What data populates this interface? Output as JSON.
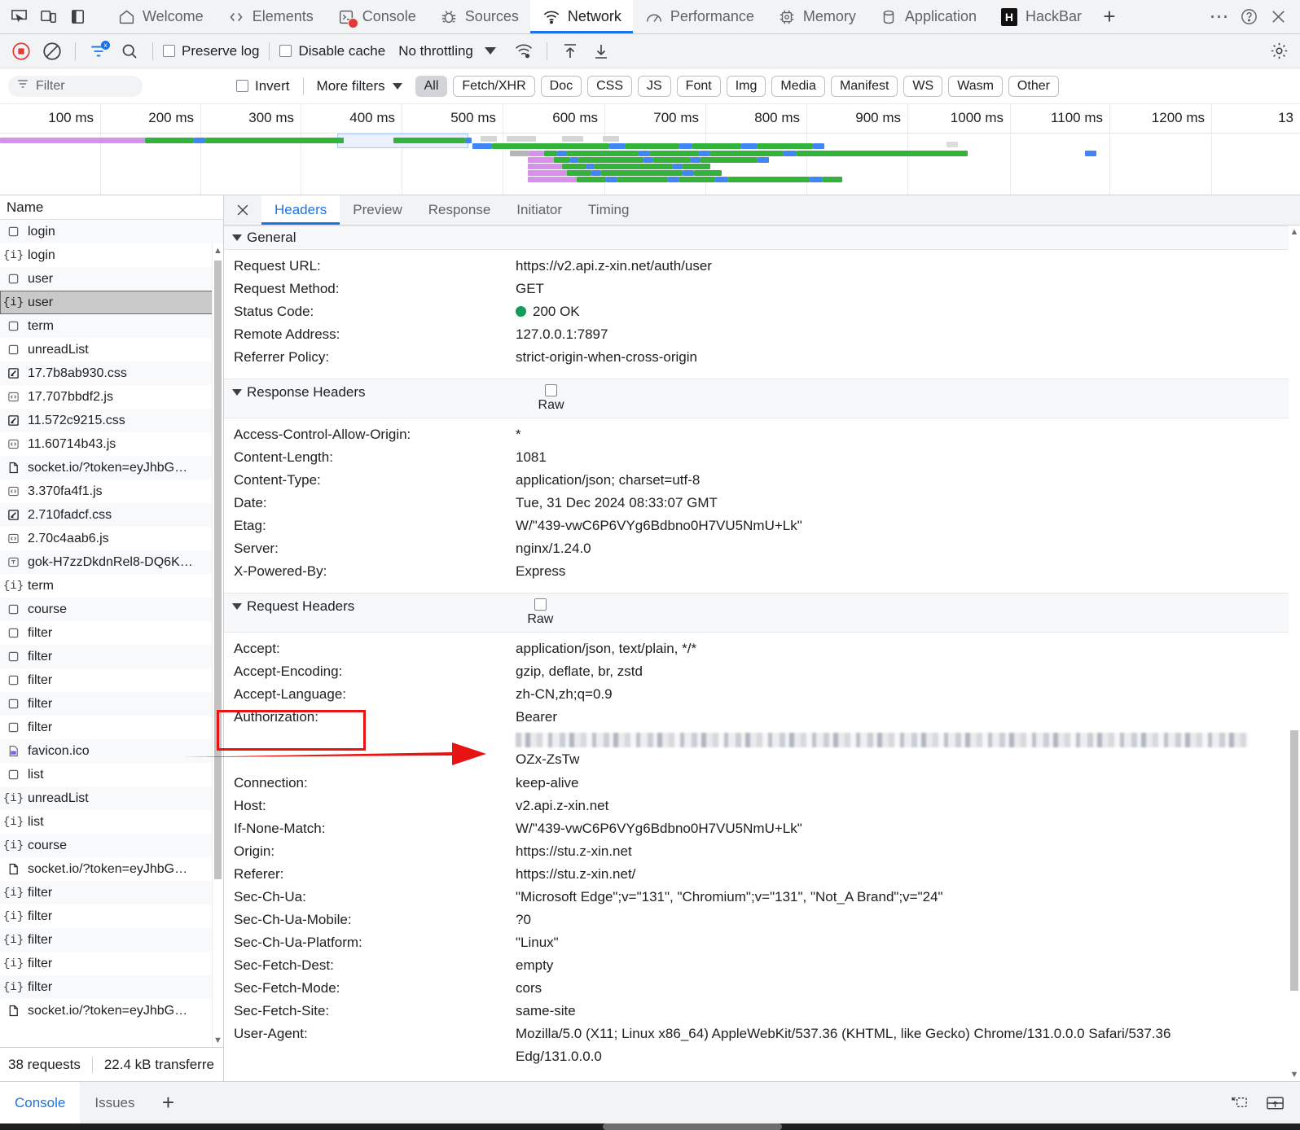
{
  "tabbar": {
    "left_icons": [
      "inspect-icon",
      "device-toolbar-icon",
      "dock-panel-icon"
    ],
    "tabs": [
      {
        "label": "Welcome",
        "icon": "home-icon",
        "active": false
      },
      {
        "label": "Elements",
        "icon": "code-brackets-icon",
        "active": false
      },
      {
        "label": "Console",
        "icon": "console-terminal-icon",
        "active": false,
        "error_badge": true
      },
      {
        "label": "Sources",
        "icon": "bug-icon",
        "active": false
      },
      {
        "label": "Network",
        "icon": "network-wifi-icon",
        "active": true
      },
      {
        "label": "Performance",
        "icon": "performance-meter-icon",
        "active": false
      },
      {
        "label": "Memory",
        "icon": "memory-chip-icon",
        "active": false
      },
      {
        "label": "Application",
        "icon": "database-icon",
        "active": false
      },
      {
        "label": "HackBar",
        "icon": "hackbar-icon",
        "active": false
      }
    ],
    "add_tab_label": "+",
    "more_label": "⋯",
    "help_label": "?",
    "close_label": "✕"
  },
  "toolbar": {
    "record_icon": "record-stop-icon",
    "clear_icon": "clear-no-entry-icon",
    "filter_icon": "filter-funnel-icon",
    "search_icon": "search-icon",
    "preserve_log_label": "Preserve log",
    "preserve_log_checked": false,
    "disable_cache_label": "Disable cache",
    "disable_cache_checked": false,
    "throttling_label": "No throttling",
    "throttle_settings_icon": "network-conditions-icon",
    "import_icon": "import-har-icon",
    "export_icon": "export-har-icon",
    "settings_icon": "gear-icon"
  },
  "filterbar": {
    "filter_placeholder": "Filter",
    "filter_value": "",
    "filter_icon": "filter-lines-icon",
    "invert_label": "Invert",
    "invert_checked": false,
    "more_filters_label": "More filters",
    "type_chips": [
      {
        "label": "All",
        "selected": true
      },
      {
        "label": "Fetch/XHR",
        "selected": false
      },
      {
        "label": "Doc",
        "selected": false
      },
      {
        "label": "CSS",
        "selected": false
      },
      {
        "label": "JS",
        "selected": false
      },
      {
        "label": "Font",
        "selected": false
      },
      {
        "label": "Img",
        "selected": false
      },
      {
        "label": "Media",
        "selected": false
      },
      {
        "label": "Manifest",
        "selected": false
      },
      {
        "label": "WS",
        "selected": false
      },
      {
        "label": "Wasm",
        "selected": false
      },
      {
        "label": "Other",
        "selected": false
      }
    ]
  },
  "overview": {
    "ticks": [
      "100 ms",
      "200 ms",
      "300 ms",
      "400 ms",
      "500 ms",
      "600 ms",
      "700 ms",
      "800 ms",
      "900 ms",
      "1000 ms",
      "1100 ms",
      "1200 ms",
      "13"
    ]
  },
  "requests": {
    "column_header": "Name",
    "rows": [
      {
        "name": "login",
        "icon": "document-icon",
        "selected": false
      },
      {
        "name": "login",
        "icon": "json-icon",
        "selected": false
      },
      {
        "name": "user",
        "icon": "document-icon",
        "selected": false
      },
      {
        "name": "user",
        "icon": "json-icon",
        "selected": true
      },
      {
        "name": "term",
        "icon": "document-icon",
        "selected": false
      },
      {
        "name": "unreadList",
        "icon": "document-icon",
        "selected": false
      },
      {
        "name": "17.7b8ab930.css",
        "icon": "css-icon",
        "selected": false
      },
      {
        "name": "17.707bbdf2.js",
        "icon": "js-icon",
        "selected": false
      },
      {
        "name": "11.572c9215.css",
        "icon": "css-icon",
        "selected": false
      },
      {
        "name": "11.60714b43.js",
        "icon": "js-icon",
        "selected": false
      },
      {
        "name": "socket.io/?token=eyJhbG…",
        "icon": "page-icon",
        "selected": false
      },
      {
        "name": "3.370fa4f1.js",
        "icon": "js-icon",
        "selected": false
      },
      {
        "name": "2.710fadcf.css",
        "icon": "css-icon",
        "selected": false
      },
      {
        "name": "2.70c4aab6.js",
        "icon": "js-icon",
        "selected": false
      },
      {
        "name": "gok-H7zzDkdnRel8-DQ6K…",
        "icon": "font-icon",
        "selected": false
      },
      {
        "name": "term",
        "icon": "json-icon",
        "selected": false
      },
      {
        "name": "course",
        "icon": "document-icon",
        "selected": false
      },
      {
        "name": "filter",
        "icon": "document-icon",
        "selected": false
      },
      {
        "name": "filter",
        "icon": "document-icon",
        "selected": false
      },
      {
        "name": "filter",
        "icon": "document-icon",
        "selected": false
      },
      {
        "name": "filter",
        "icon": "document-icon",
        "selected": false
      },
      {
        "name": "filter",
        "icon": "document-icon",
        "selected": false
      },
      {
        "name": "favicon.ico",
        "icon": "image-icon",
        "selected": false
      },
      {
        "name": "list",
        "icon": "document-icon",
        "selected": false
      },
      {
        "name": "unreadList",
        "icon": "json-icon",
        "selected": false
      },
      {
        "name": "list",
        "icon": "json-icon",
        "selected": false
      },
      {
        "name": "course",
        "icon": "json-icon",
        "selected": false
      },
      {
        "name": "socket.io/?token=eyJhbG…",
        "icon": "page-icon",
        "selected": false
      },
      {
        "name": "filter",
        "icon": "json-icon",
        "selected": false
      },
      {
        "name": "filter",
        "icon": "json-icon",
        "selected": false
      },
      {
        "name": "filter",
        "icon": "json-icon",
        "selected": false
      },
      {
        "name": "filter",
        "icon": "json-icon",
        "selected": false
      },
      {
        "name": "filter",
        "icon": "json-icon",
        "selected": false
      },
      {
        "name": "socket.io/?token=eyJhbG…",
        "icon": "page-icon",
        "selected": false
      }
    ],
    "status": {
      "requests_count": "38 requests",
      "transferred": "22.4 kB transferre"
    }
  },
  "detail": {
    "close_icon": "close-icon",
    "tabs": [
      {
        "label": "Headers",
        "active": true
      },
      {
        "label": "Preview",
        "active": false
      },
      {
        "label": "Response",
        "active": false
      },
      {
        "label": "Initiator",
        "active": false
      },
      {
        "label": "Timing",
        "active": false
      }
    ],
    "general": {
      "title": "General",
      "rows": [
        {
          "key": "Request URL:",
          "value": "https://v2.api.z-xin.net/auth/user"
        },
        {
          "key": "Request Method:",
          "value": "GET"
        },
        {
          "key": "Status Code:",
          "value": "200 OK",
          "status_dot": "#0f9d58"
        },
        {
          "key": "Remote Address:",
          "value": "127.0.0.1:7897"
        },
        {
          "key": "Referrer Policy:",
          "value": "strict-origin-when-cross-origin"
        }
      ]
    },
    "response_headers": {
      "title": "Response Headers",
      "raw_label": "Raw",
      "raw_checked": false,
      "rows": [
        {
          "key": "Access-Control-Allow-Origin:",
          "value": "*"
        },
        {
          "key": "Content-Length:",
          "value": "1081"
        },
        {
          "key": "Content-Type:",
          "value": "application/json; charset=utf-8"
        },
        {
          "key": "Date:",
          "value": "Tue, 31 Dec 2024 08:33:07 GMT"
        },
        {
          "key": "Etag:",
          "value": "W/\"439-vwC6P6VYg6Bdbno0H7VU5NmU+Lk\""
        },
        {
          "key": "Server:",
          "value": "nginx/1.24.0"
        },
        {
          "key": "X-Powered-By:",
          "value": "Express"
        }
      ]
    },
    "request_headers": {
      "title": "Request Headers",
      "raw_label": "Raw",
      "raw_checked": false,
      "rows": [
        {
          "key": "Accept:",
          "value": "application/json, text/plain, */*"
        },
        {
          "key": "Accept-Encoding:",
          "value": "gzip, deflate, br, zstd"
        },
        {
          "key": "Accept-Language:",
          "value": "zh-CN,zh;q=0.9"
        },
        {
          "key": "Authorization:",
          "value": "Bearer",
          "redacted": true,
          "value_tail": "OZx-ZsTw"
        },
        {
          "key": "Connection:",
          "value": "keep-alive"
        },
        {
          "key": "Host:",
          "value": "v2.api.z-xin.net"
        },
        {
          "key": "If-None-Match:",
          "value": "W/\"439-vwC6P6VYg6Bdbno0H7VU5NmU+Lk\""
        },
        {
          "key": "Origin:",
          "value": "https://stu.z-xin.net"
        },
        {
          "key": "Referer:",
          "value": "https://stu.z-xin.net/"
        },
        {
          "key": "Sec-Ch-Ua:",
          "value": "\"Microsoft Edge\";v=\"131\", \"Chromium\";v=\"131\", \"Not_A Brand\";v=\"24\""
        },
        {
          "key": "Sec-Ch-Ua-Mobile:",
          "value": "?0"
        },
        {
          "key": "Sec-Ch-Ua-Platform:",
          "value": "\"Linux\""
        },
        {
          "key": "Sec-Fetch-Dest:",
          "value": "empty"
        },
        {
          "key": "Sec-Fetch-Mode:",
          "value": "cors"
        },
        {
          "key": "Sec-Fetch-Site:",
          "value": "same-site"
        },
        {
          "key": "User-Agent:",
          "value": "Mozilla/5.0 (X11; Linux x86_64) AppleWebKit/537.36 (KHTML, like Gecko) Chrome/131.0.0.0 Safari/537.36"
        },
        {
          "key": "",
          "value": "Edg/131.0.0.0"
        }
      ]
    }
  },
  "annotations": {
    "highlight_target": "Authorization:",
    "color": "#e81313"
  },
  "drawer": {
    "tabs": [
      {
        "label": "Console",
        "active": true
      },
      {
        "label": "Issues",
        "active": false
      }
    ],
    "add_label": "+",
    "right_icons": [
      "restore-drawer-icon",
      "dock-bottom-icon"
    ]
  }
}
